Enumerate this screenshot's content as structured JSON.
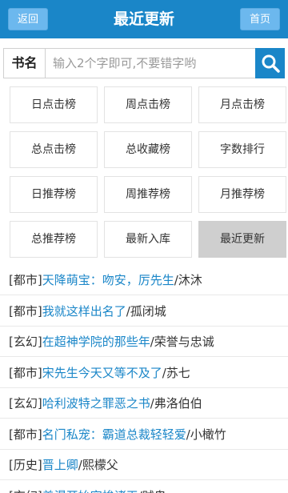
{
  "header": {
    "back_label": "返回",
    "title": "最近更新",
    "home_label": "首页"
  },
  "search": {
    "label": "书名",
    "placeholder": "输入2个字即可,不要错字哟"
  },
  "nav": [
    "日点击榜",
    "周点击榜",
    "月点击榜",
    "总点击榜",
    "总收藏榜",
    "字数排行",
    "日推荐榜",
    "周推荐榜",
    "月推荐榜",
    "总推荐榜",
    "最新入库",
    "最近更新"
  ],
  "nav_active": "最近更新",
  "books": [
    {
      "category": "[都市]",
      "title": "天降萌宝：吻安，厉先生",
      "author": "沐沐"
    },
    {
      "category": "[都市]",
      "title": "我就这样出名了",
      "author": "孤闭城"
    },
    {
      "category": "[玄幻]",
      "title": "在超神学院的那些年",
      "author": "荣誉与忠诚"
    },
    {
      "category": "[都市]",
      "title": "宋先生今天又等不及了",
      "author": "苏七"
    },
    {
      "category": "[玄幻]",
      "title": "哈利波特之罪恶之书",
      "author": "弗洛伯伯"
    },
    {
      "category": "[都市]",
      "title": "名门私宠：霸道总裁轻轻爱",
      "author": "小橄竹"
    },
    {
      "category": "[历史]",
      "title": "晋上卿",
      "author": "熙檬父"
    },
    {
      "category": "[玄幻]",
      "title": "盖漫开始穿梭诸天",
      "author": "贼鬼"
    }
  ],
  "colors": {
    "header": "#1a86c8",
    "link": "#1a86c8",
    "active_cell": "#cfcfcf"
  }
}
